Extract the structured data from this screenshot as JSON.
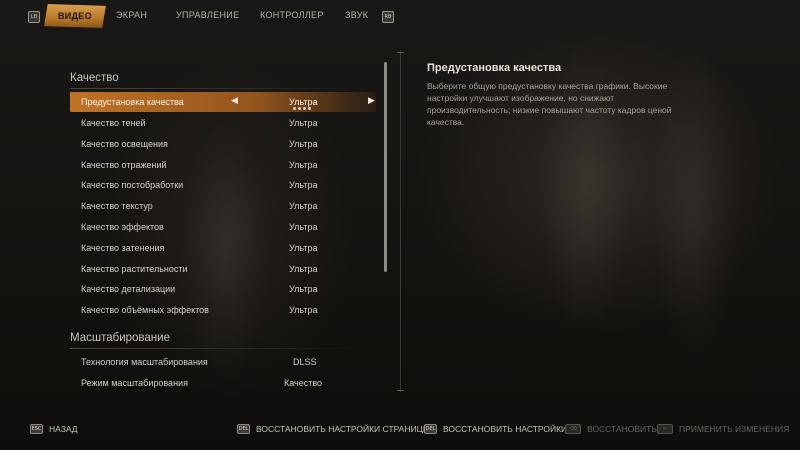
{
  "tabs": {
    "left_key": "LB",
    "right_key": "RB",
    "items": [
      {
        "label": "ВИДЕО"
      },
      {
        "label": "ЭКРАН"
      },
      {
        "label": "УПРАВЛЕНИЕ"
      },
      {
        "label": "КОНТРОЛЛЕР"
      },
      {
        "label": "ЗВУК"
      }
    ],
    "active_index": 0
  },
  "quality": {
    "title": "Качество",
    "rows": [
      {
        "label": "Предустановка качества",
        "value": "Ультра"
      },
      {
        "label": "Качество теней",
        "value": "Ультра"
      },
      {
        "label": "Качество освещения",
        "value": "Ультра"
      },
      {
        "label": "Качество отражений",
        "value": "Ультра"
      },
      {
        "label": "Качество постобработки",
        "value": "Ультра"
      },
      {
        "label": "Качество текстур",
        "value": "Ультра"
      },
      {
        "label": "Качество эффектов",
        "value": "Ультра"
      },
      {
        "label": "Качество затенения",
        "value": "Ультра"
      },
      {
        "label": "Качество растительности",
        "value": "Ультра"
      },
      {
        "label": "Качество детализации",
        "value": "Ультра"
      },
      {
        "label": "Качество объёмных эффектов",
        "value": "Ультра"
      }
    ],
    "selected_index": 0,
    "arrow_left": "◀",
    "arrow_right": "▶"
  },
  "scaling": {
    "title": "Масштабирование",
    "rows": [
      {
        "label": "Технология масштабирования",
        "value": "DLSS"
      },
      {
        "label": "Режим масштабирования",
        "value": "Качество"
      }
    ]
  },
  "description": {
    "title": "Предустановка качества",
    "text": "Выберите общую предустановку качества графики. Высокие настройки улучшают изображение, но снижают производительность; низкие повышают частоту кадров ценой качества."
  },
  "bottom": {
    "back": {
      "key": "Esc",
      "label": "НАЗАД"
    },
    "reset_page": {
      "key": "Del",
      "label": "ВОССТАНОВИТЬ НАСТРОЙКИ СТРАНИЦЫ"
    },
    "reset_all": {
      "key": "Del",
      "label": "ВОССТАНОВИТЬ НАСТРОЙКИ"
    },
    "restore": {
      "key": "⌫",
      "label": "ВОССТАНОВИТЬ"
    },
    "apply": {
      "key": "↵",
      "label": "ПРИМЕНИТЬ ИЗМЕНЕНИЯ"
    }
  },
  "colors": {
    "accent": "#c87828",
    "text": "#d6d0c6",
    "muted": "#6a665f"
  }
}
